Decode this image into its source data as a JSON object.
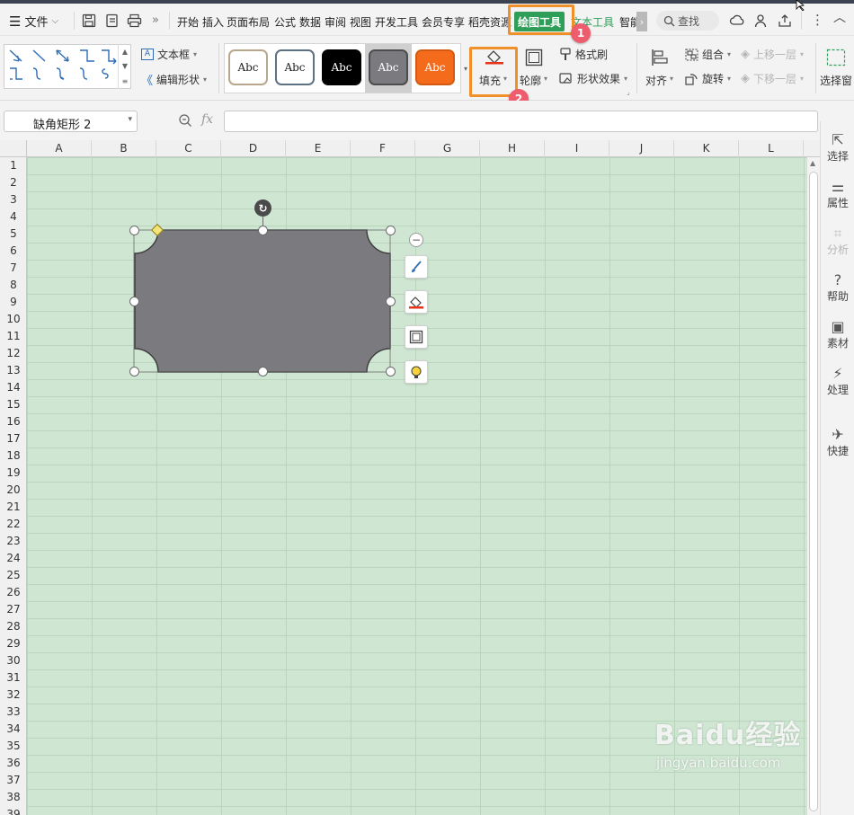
{
  "menubar": {
    "file_label": "文件",
    "tabs": [
      "开始",
      "插入",
      "页面布局",
      "公式",
      "数据",
      "审阅",
      "视图",
      "开发工具",
      "会员专享",
      "稻壳资源"
    ],
    "active_tab": "绘图工具",
    "next_tab": "文本工具",
    "cut_tab": "智能",
    "search_label": "查找"
  },
  "ribbon": {
    "textbox_label": "文本框",
    "edit_shape_label": "编辑形状",
    "style_presets": [
      {
        "text": "Abc",
        "bg": "#ffffff",
        "border": "#b8a78a",
        "color": "#222222"
      },
      {
        "text": "Abc",
        "bg": "#ffffff",
        "border": "#5d7184",
        "color": "#222222"
      },
      {
        "text": "Abc",
        "bg": "#000000",
        "border": "#000000",
        "color": "#ffffff"
      },
      {
        "text": "Abc",
        "bg": "#7b7b7f",
        "border": "#4c4c4e",
        "color": "#ffffff"
      },
      {
        "text": "Abc",
        "bg": "#f46b1c",
        "border": "#d45a12",
        "color": "#ffffff"
      }
    ],
    "fill_label": "填充",
    "outline_label": "轮廓",
    "format_painter_label": "格式刷",
    "shape_effect_label": "形状效果",
    "align_label": "对齐",
    "group_label": "组合",
    "rotate_label": "旋转",
    "bring_forward_label": "上移一层",
    "send_backward_label": "下移一层",
    "select_pane_label": "选择窗"
  },
  "callouts": {
    "badge1": "1",
    "badge2": "2"
  },
  "formulabar": {
    "name_box": "缺角矩形 2",
    "fx_label": "fx",
    "formula": ""
  },
  "sheet": {
    "columns": [
      "A",
      "B",
      "C",
      "D",
      "E",
      "F",
      "G",
      "H",
      "I",
      "J",
      "K",
      "L"
    ],
    "rows": [
      "1",
      "2",
      "3",
      "4",
      "5",
      "6",
      "7",
      "8",
      "9",
      "10",
      "11",
      "12",
      "13",
      "14",
      "15",
      "16",
      "17",
      "18",
      "19",
      "20",
      "21",
      "22",
      "23",
      "24",
      "25",
      "26",
      "27",
      "28",
      "29",
      "30",
      "31",
      "32",
      "33",
      "34",
      "35",
      "36",
      "37",
      "38",
      "39"
    ]
  },
  "shape": {
    "fill": "#7b7b7f",
    "stroke": "#3f3f3f"
  },
  "sidebar": {
    "items": [
      "选择",
      "属性",
      "分析",
      "帮助",
      "素材",
      "处理",
      "快捷"
    ]
  },
  "watermark": {
    "brand": "Baidu经验",
    "url": "jingyan.baidu.com"
  },
  "colors": {
    "accent_orange": "#f0902a",
    "active_tab_green": "#2f9e58",
    "badge_red": "#ee5d6e",
    "sheet_bg": "#cfe7d2"
  }
}
